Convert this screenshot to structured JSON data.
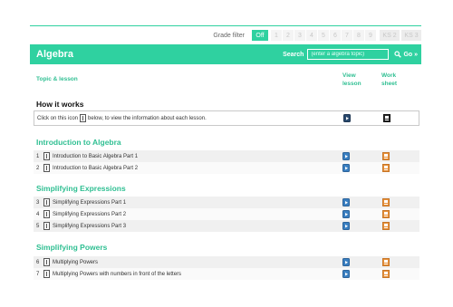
{
  "grade_filter": {
    "label": "Grade filter",
    "selected": "Off",
    "grades": [
      "1",
      "2",
      "3",
      "4",
      "5",
      "6",
      "7",
      "8",
      "9"
    ],
    "key_stages": [
      "KS 2",
      "KS 3"
    ]
  },
  "header": {
    "title": "Algebra",
    "search_label": "Search",
    "search_placeholder": "(enter a algebra topic)",
    "go_label": "Go »"
  },
  "columns": {
    "topic": "Topic & lesson",
    "view_line1": "View",
    "view_line2": "lesson",
    "work_line1": "Work",
    "work_line2": "sheet"
  },
  "how_it_works": {
    "title": "How it works",
    "text_before": "Click on this icon",
    "text_after": "below, to view the information about each lesson."
  },
  "sections": [
    {
      "title": "Introduction to Algebra",
      "lessons": [
        {
          "num": "1",
          "label": "Introduction to Basic Algebra Part 1"
        },
        {
          "num": "2",
          "label": "Introduction to Basic Algebra Part 2"
        }
      ]
    },
    {
      "title": "Simplifying Expressions",
      "lessons": [
        {
          "num": "3",
          "label": "Simplifying Expressions Part 1"
        },
        {
          "num": "4",
          "label": "Simplifying Expressions Part 2"
        },
        {
          "num": "5",
          "label": "Simplifying Expressions Part 3"
        }
      ]
    },
    {
      "title": "Simplifying Powers",
      "lessons": [
        {
          "num": "6",
          "label": "Multiplying Powers"
        },
        {
          "num": "7",
          "label": "Multiplying Powers with numbers in front of the letters"
        }
      ]
    }
  ],
  "colors": {
    "accent": "#2fd1a0",
    "view_icon": "#3a7fc1",
    "work_icon": "#e8913a"
  }
}
